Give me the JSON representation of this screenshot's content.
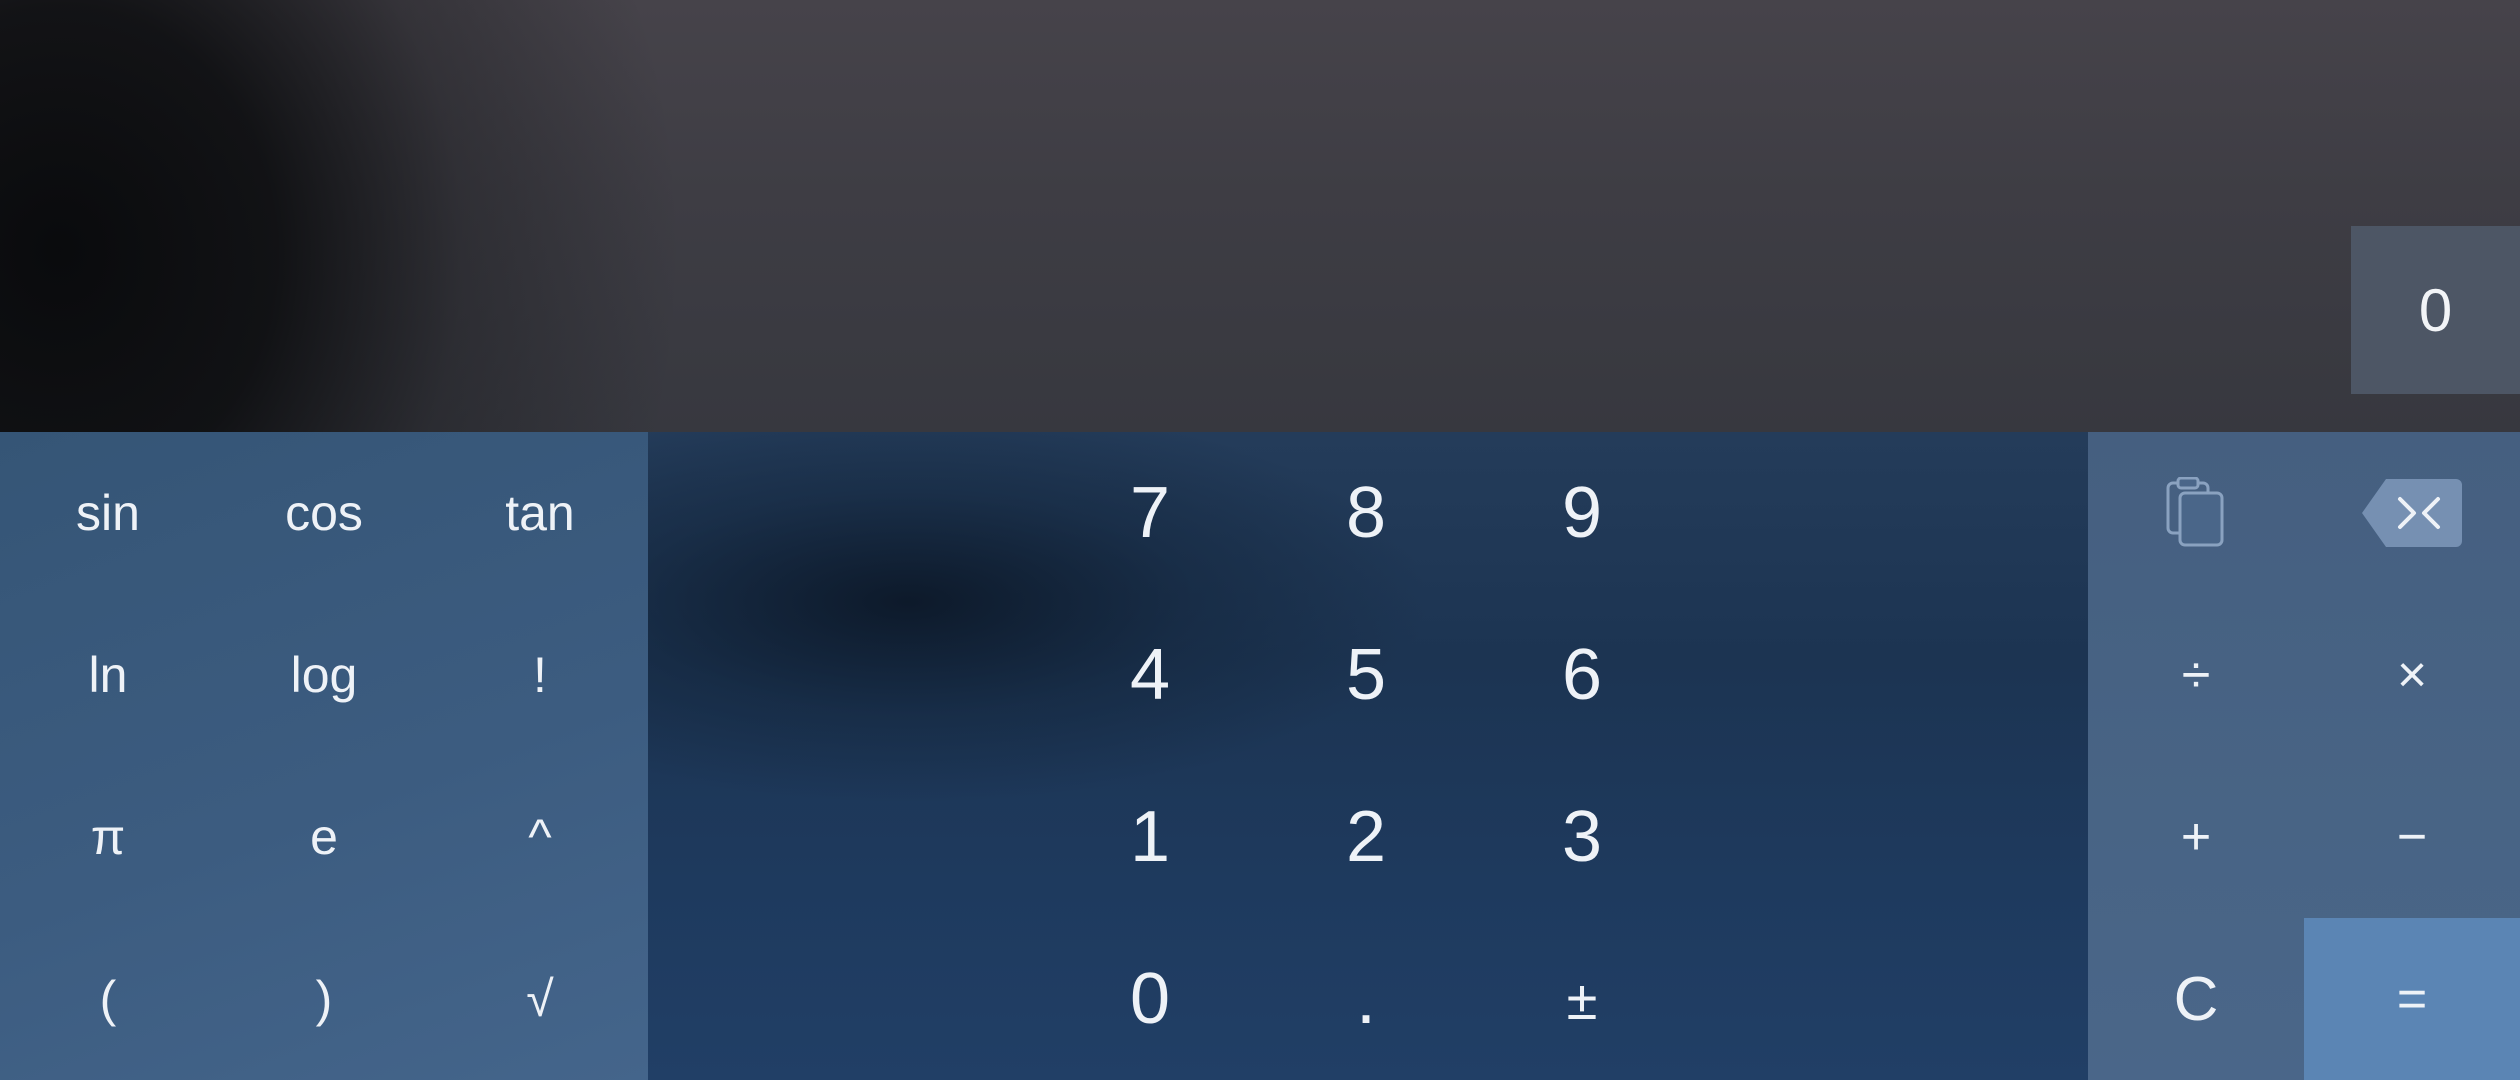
{
  "display": {
    "result": "0"
  },
  "scientific_keys": [
    {
      "label": "sin"
    },
    {
      "label": "cos"
    },
    {
      "label": "tan"
    },
    {
      "label": "ln"
    },
    {
      "label": "log"
    },
    {
      "label": "!"
    },
    {
      "label": "π"
    },
    {
      "label": "e"
    },
    {
      "label": "^"
    },
    {
      "label": "("
    },
    {
      "label": ")"
    },
    {
      "label": "√"
    }
  ],
  "number_keys": [
    {
      "label": "7"
    },
    {
      "label": "8"
    },
    {
      "label": "9"
    },
    {
      "label": "4"
    },
    {
      "label": "5"
    },
    {
      "label": "6"
    },
    {
      "label": "1"
    },
    {
      "label": "2"
    },
    {
      "label": "3"
    },
    {
      "label": "0"
    },
    {
      "label": "."
    },
    {
      "label": "±"
    }
  ],
  "operator_keys": {
    "clipboard_icon": "clipboard-icon",
    "backspace_icon": "backspace-icon",
    "divide": "÷",
    "multiply": "×",
    "plus": "+",
    "minus": "−",
    "clear": "C",
    "equals": "="
  },
  "colors": {
    "display_background": "#3e3d44",
    "result_box": "#4d5665",
    "scientific_panel": "#3c5c80",
    "number_panel": "#1e3a5e",
    "operator_panel": "#486485",
    "equals_key": "#5b85b4",
    "key_text": "#eef2f7"
  }
}
